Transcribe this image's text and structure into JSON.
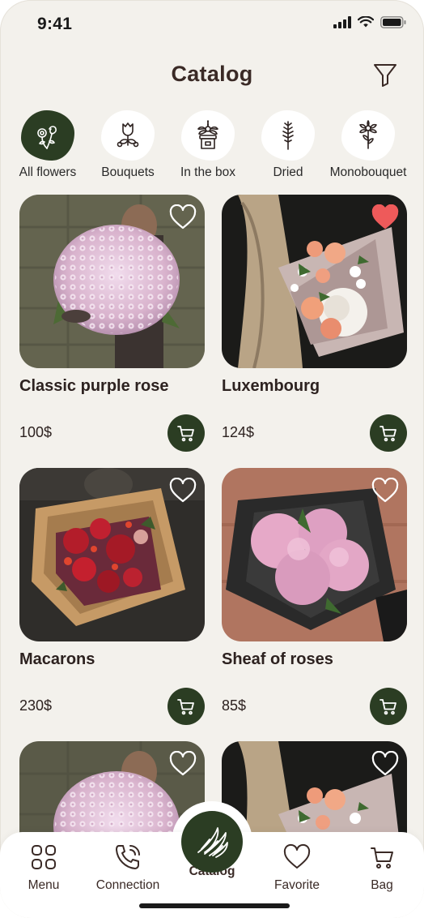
{
  "status_bar": {
    "time": "9:41"
  },
  "header": {
    "title": "Catalog"
  },
  "categories": [
    {
      "label": "All flowers",
      "icon": "flowers-icon",
      "active": true
    },
    {
      "label": "Bouquets",
      "icon": "bouquet-icon",
      "active": false
    },
    {
      "label": "In the box",
      "icon": "flower-box-icon",
      "active": false
    },
    {
      "label": "Dried",
      "icon": "dried-branch-icon",
      "active": false
    },
    {
      "label": "Monobouquet",
      "icon": "monobouquet-icon",
      "active": false
    }
  ],
  "products": [
    {
      "name": "Classic purple rose",
      "price": "100$",
      "favorite": false
    },
    {
      "name": "Luxembourg",
      "price": "124$",
      "favorite": true
    },
    {
      "name": "Macarons",
      "price": "230$",
      "favorite": false
    },
    {
      "name": "Sheaf of roses",
      "price": "85$",
      "favorite": false
    },
    {
      "name": "",
      "price": "",
      "favorite": false
    },
    {
      "name": "",
      "price": "",
      "favorite": false
    }
  ],
  "nav": {
    "menu": "Menu",
    "connection": "Connection",
    "catalog": "Catalog",
    "favorite": "Favorite",
    "bag": "Bag"
  },
  "colors": {
    "accent": "#2b3d23",
    "background": "#f3f1ec",
    "favorite_heart": "#ee5a5a",
    "text": "#2d2220"
  }
}
